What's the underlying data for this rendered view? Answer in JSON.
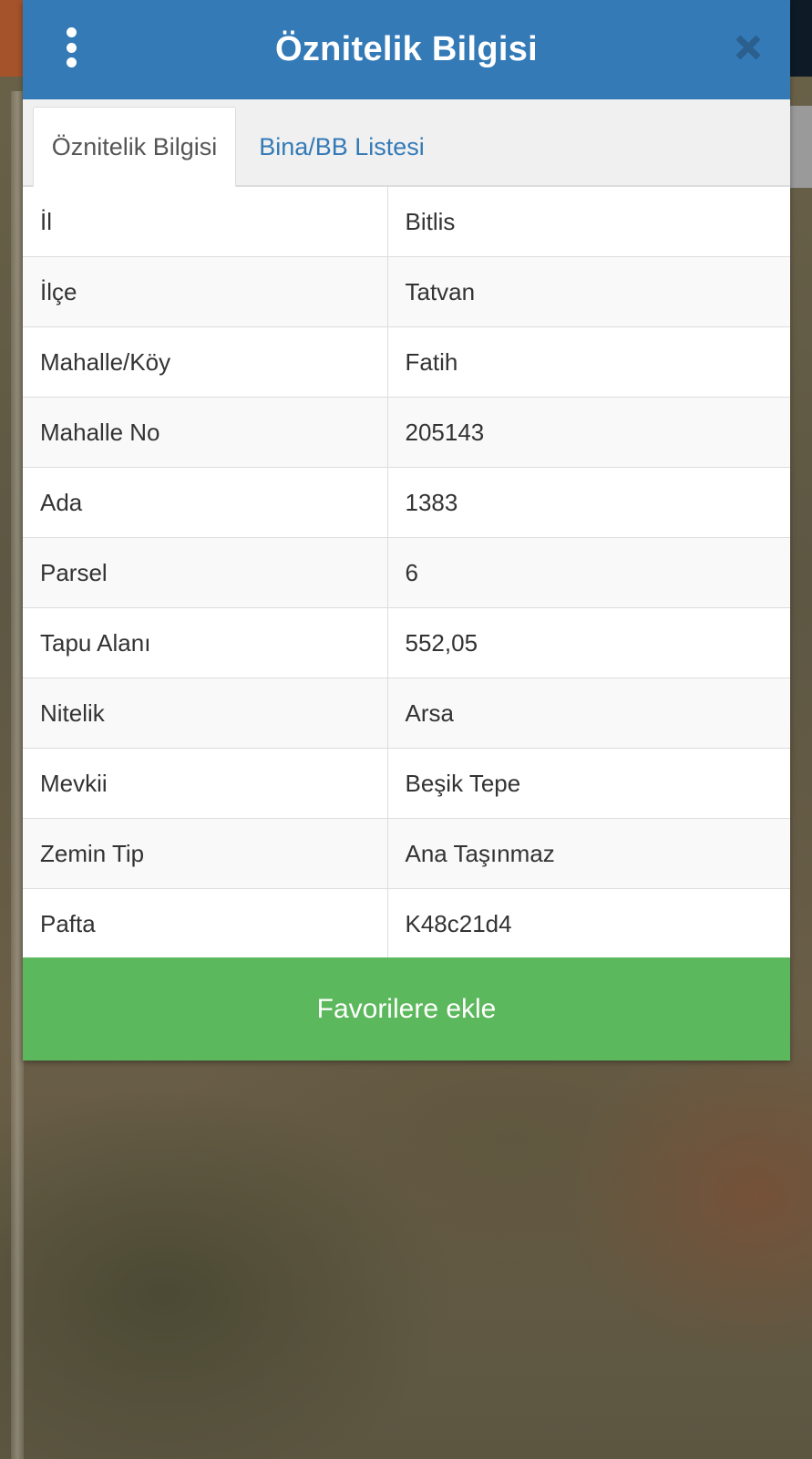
{
  "header": {
    "title": "Öznitelik Bilgisi",
    "menu_icon": "vertical-ellipsis-icon",
    "close_icon": "close-icon"
  },
  "tabs": [
    {
      "label": "Öznitelik Bilgisi",
      "active": true
    },
    {
      "label": "Bina/BB Listesi",
      "active": false
    }
  ],
  "attributes": [
    {
      "key": "İl",
      "value": "Bitlis"
    },
    {
      "key": "İlçe",
      "value": "Tatvan"
    },
    {
      "key": "Mahalle/Köy",
      "value": "Fatih"
    },
    {
      "key": "Mahalle No",
      "value": "205143"
    },
    {
      "key": "Ada",
      "value": "1383"
    },
    {
      "key": "Parsel",
      "value": "6"
    },
    {
      "key": "Tapu Alanı",
      "value": "552,05"
    },
    {
      "key": "Nitelik",
      "value": "Arsa"
    },
    {
      "key": "Mevkii",
      "value": "Beşik Tepe"
    },
    {
      "key": "Zemin Tip",
      "value": "Ana Taşınmaz"
    },
    {
      "key": "Pafta",
      "value": "K48c21d4"
    }
  ],
  "actions": {
    "favorite_label": "Favorilere ekle"
  },
  "colors": {
    "header": "#337ab7",
    "tab_link": "#337ab7",
    "favorite_button": "#5cb85c"
  }
}
